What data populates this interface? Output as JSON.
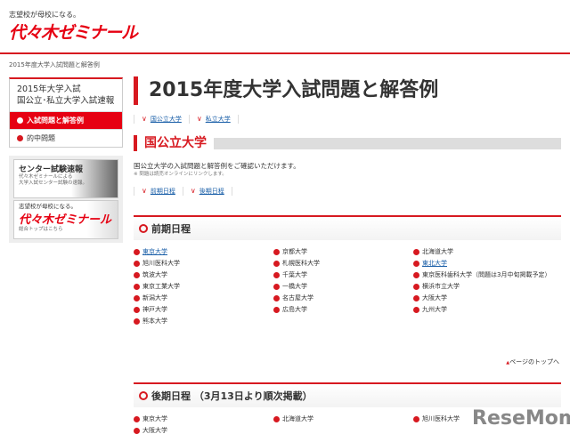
{
  "header": {
    "tagline": "志望校が母校になる。",
    "logo": "代々木ゼミナール"
  },
  "breadcrumb": "2015年度大学入試問題と解答例",
  "sidebar": {
    "title1": "2015年大学入試",
    "title2": "国公立･私立大学入試速報",
    "items": [
      {
        "label": "入試問題と解答例",
        "active": true
      },
      {
        "label": "的中問題"
      }
    ]
  },
  "banners": {
    "center_title": "センター試験速報",
    "center_sub1": "代々木ゼミナールによる",
    "center_sub2": "大学入試センター試験の速報。",
    "top_tagline": "志望校が母校になる。",
    "top_logo": "代々木ゼミナール",
    "top_sub": "総合トップはこちら"
  },
  "main": {
    "title": "2015年度大学入試問題と解答例",
    "tabs": [
      "国公立大学",
      "私立大学"
    ],
    "section": "国公立大学",
    "intro": "国公立大学の入試問題と解答例をご確認いただけます。",
    "note": "※ 問題は読売オンラインにリンクします。",
    "subtabs": [
      "前期日程",
      "後期日程"
    ],
    "zenki": {
      "heading": "前期日程",
      "items": [
        {
          "name": "東京大学",
          "link": true
        },
        {
          "name": "京都大学"
        },
        {
          "name": "北海道大学"
        },
        {
          "name": "旭川医科大学"
        },
        {
          "name": "札幌医科大学"
        },
        {
          "name": "東北大学",
          "link": true
        },
        {
          "name": "筑波大学"
        },
        {
          "name": "千葉大学"
        },
        {
          "name": "東京医科歯科大学（問題は3月中旬掲載予定）"
        },
        {
          "name": "東京工業大学"
        },
        {
          "name": "一橋大学"
        },
        {
          "name": "横浜市立大学"
        },
        {
          "name": "新潟大学"
        },
        {
          "name": "名古屋大学"
        },
        {
          "name": "大阪大学"
        },
        {
          "name": "神戸大学"
        },
        {
          "name": "広島大学"
        },
        {
          "name": "九州大学"
        },
        {
          "name": "熊本大学"
        }
      ]
    },
    "page_top": "ページのトップへ",
    "kouki": {
      "heading": "後期日程 （3月13日より順次掲載）",
      "items": [
        {
          "name": "東京大学"
        },
        {
          "name": "北海道大学"
        },
        {
          "name": "旭川医科大学"
        },
        {
          "name": "大阪大学"
        }
      ]
    }
  },
  "watermark": "ReseMom"
}
